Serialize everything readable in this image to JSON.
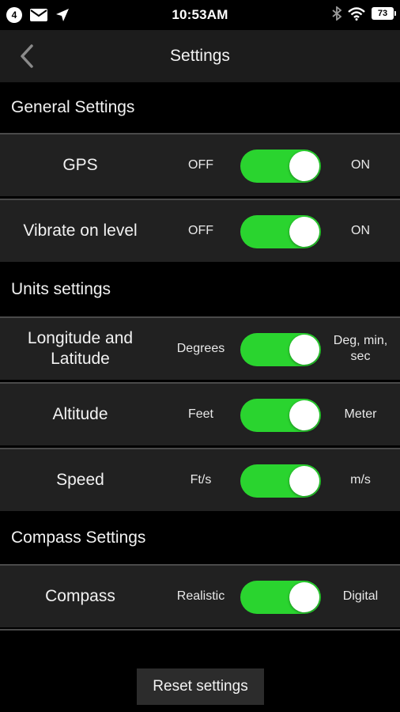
{
  "status_bar": {
    "notification_count": "4",
    "time": "10:53AM",
    "battery": "73",
    "icons": [
      "notification-badge",
      "mail-icon",
      "location-arrow-icon",
      "bluetooth-icon",
      "wifi-icon",
      "battery-icon"
    ]
  },
  "nav": {
    "title": "Settings",
    "back_icon": "chevron-left-icon"
  },
  "sections": {
    "general": {
      "title": "General Settings",
      "rows": {
        "gps": {
          "label": "GPS",
          "off": "OFF",
          "on": "ON",
          "value": "on"
        },
        "vibrate": {
          "label": "Vibrate on level",
          "off": "OFF",
          "on": "ON",
          "value": "on"
        }
      }
    },
    "units": {
      "title": "Units settings",
      "rows": {
        "lonlat": {
          "label_line1": "Longitude and",
          "label_line2": "Latitude",
          "off": "Degrees",
          "on_line1": "Deg, min,",
          "on_line2": "sec",
          "value": "on"
        },
        "altitude": {
          "label": "Altitude",
          "off": "Feet",
          "on": "Meter",
          "value": "on"
        },
        "speed": {
          "label": "Speed",
          "off": "Ft/s",
          "on": "m/s",
          "value": "on"
        }
      }
    },
    "compass": {
      "title": "Compass Settings",
      "rows": {
        "compass": {
          "label": "Compass",
          "off": "Realistic",
          "on": "Digital",
          "value": "on"
        }
      }
    }
  },
  "reset_label": "Reset settings",
  "colors": {
    "toggle_on": "#2ad42f",
    "row_bg": "#212121",
    "nav_bg": "#1c1c1c",
    "page_bg": "#000000"
  }
}
